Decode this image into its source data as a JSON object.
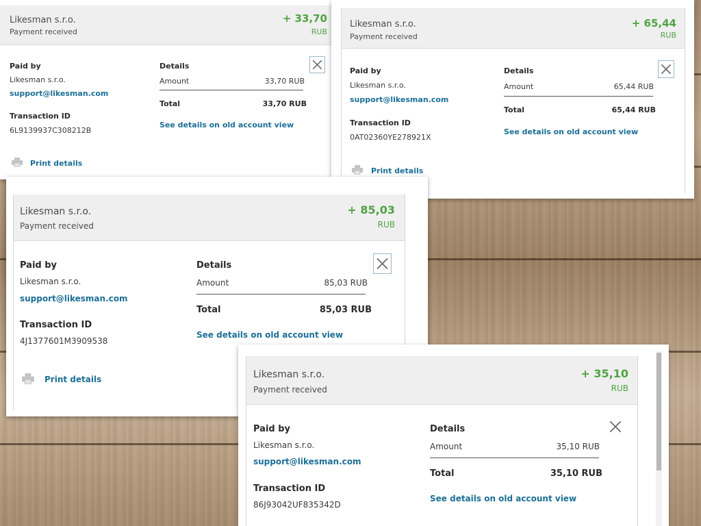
{
  "common": {
    "merchant": "Likesman s.r.o.",
    "status": "Payment received",
    "currency": "RUB",
    "paid_by_label": "Paid by",
    "paid_by_name": "Likesman s.r.o.",
    "paid_by_email": "support@likesman.com",
    "transaction_label": "Transaction ID",
    "details_label": "Details",
    "amount_label": "Amount",
    "total_label": "Total",
    "old_view_link": "See details on old account view",
    "print_label": "Print details"
  },
  "cards": [
    {
      "amount": "+ 33,70",
      "row_amount": "33,70 RUB",
      "row_total": "33,70 RUB",
      "transaction_id": "6L9139937C308212B"
    },
    {
      "amount": "+ 65,44",
      "row_amount": "65,44 RUB",
      "row_total": "65,44 RUB",
      "transaction_id": "0AT02360YE278921X"
    },
    {
      "amount": "+ 85,03",
      "row_amount": "85,03 RUB",
      "row_total": "85,03 RUB",
      "transaction_id": "4J1377601M3909538"
    },
    {
      "amount": "+ 35,10",
      "row_amount": "35,10 RUB",
      "row_total": "35,10 RUB",
      "transaction_id": "86J93042UF835342D"
    }
  ],
  "colors": {
    "amount_green": "#4fa342",
    "link_blue": "#1b6f96",
    "header_gray": "#efefef",
    "wood_brown": "#a58a6f"
  },
  "icons": [
    "close-icon",
    "printer-icon"
  ]
}
